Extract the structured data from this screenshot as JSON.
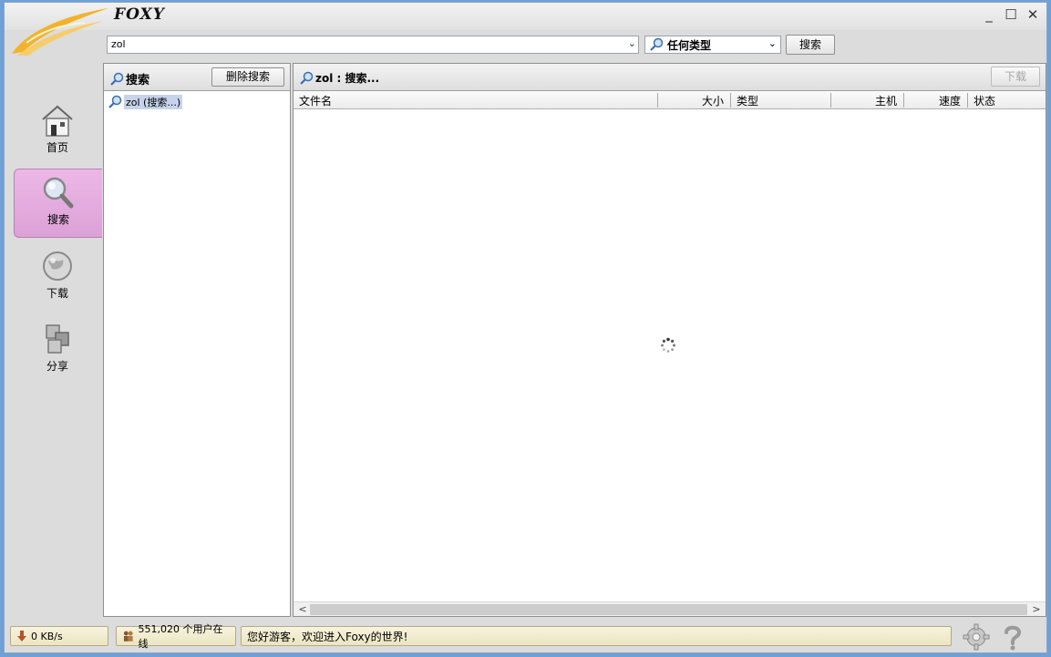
{
  "app": {
    "title": "FOXY"
  },
  "window_controls": {
    "minimize": "_",
    "maximize": "☐",
    "close": "✕"
  },
  "search": {
    "query": "zol",
    "type_selected": "任何类型",
    "search_button": "搜索"
  },
  "nav": {
    "items": [
      {
        "label": "首页",
        "icon": "home-icon"
      },
      {
        "label": "搜索",
        "icon": "search-icon",
        "active": true
      },
      {
        "label": "下载",
        "icon": "globe-icon"
      },
      {
        "label": "分享",
        "icon": "share-icon"
      }
    ]
  },
  "left_panel": {
    "title": "搜索",
    "delete_button": "删除搜索",
    "items": [
      {
        "label": "zol (搜索...)"
      }
    ]
  },
  "right_panel": {
    "title": "zol : 搜索...",
    "download_button": "下载",
    "columns": [
      "文件名",
      "大小",
      "类型",
      "主机",
      "速度",
      "状态"
    ]
  },
  "status": {
    "speed": "0 KB/s",
    "users_online": "551,020 个用户在线",
    "message": "您好游客，欢迎进入Foxy的世界!"
  },
  "colors": {
    "active_nav": "#dca1d7",
    "window_bg": "#dcdcdc",
    "desktop": "#6fa0d6"
  }
}
